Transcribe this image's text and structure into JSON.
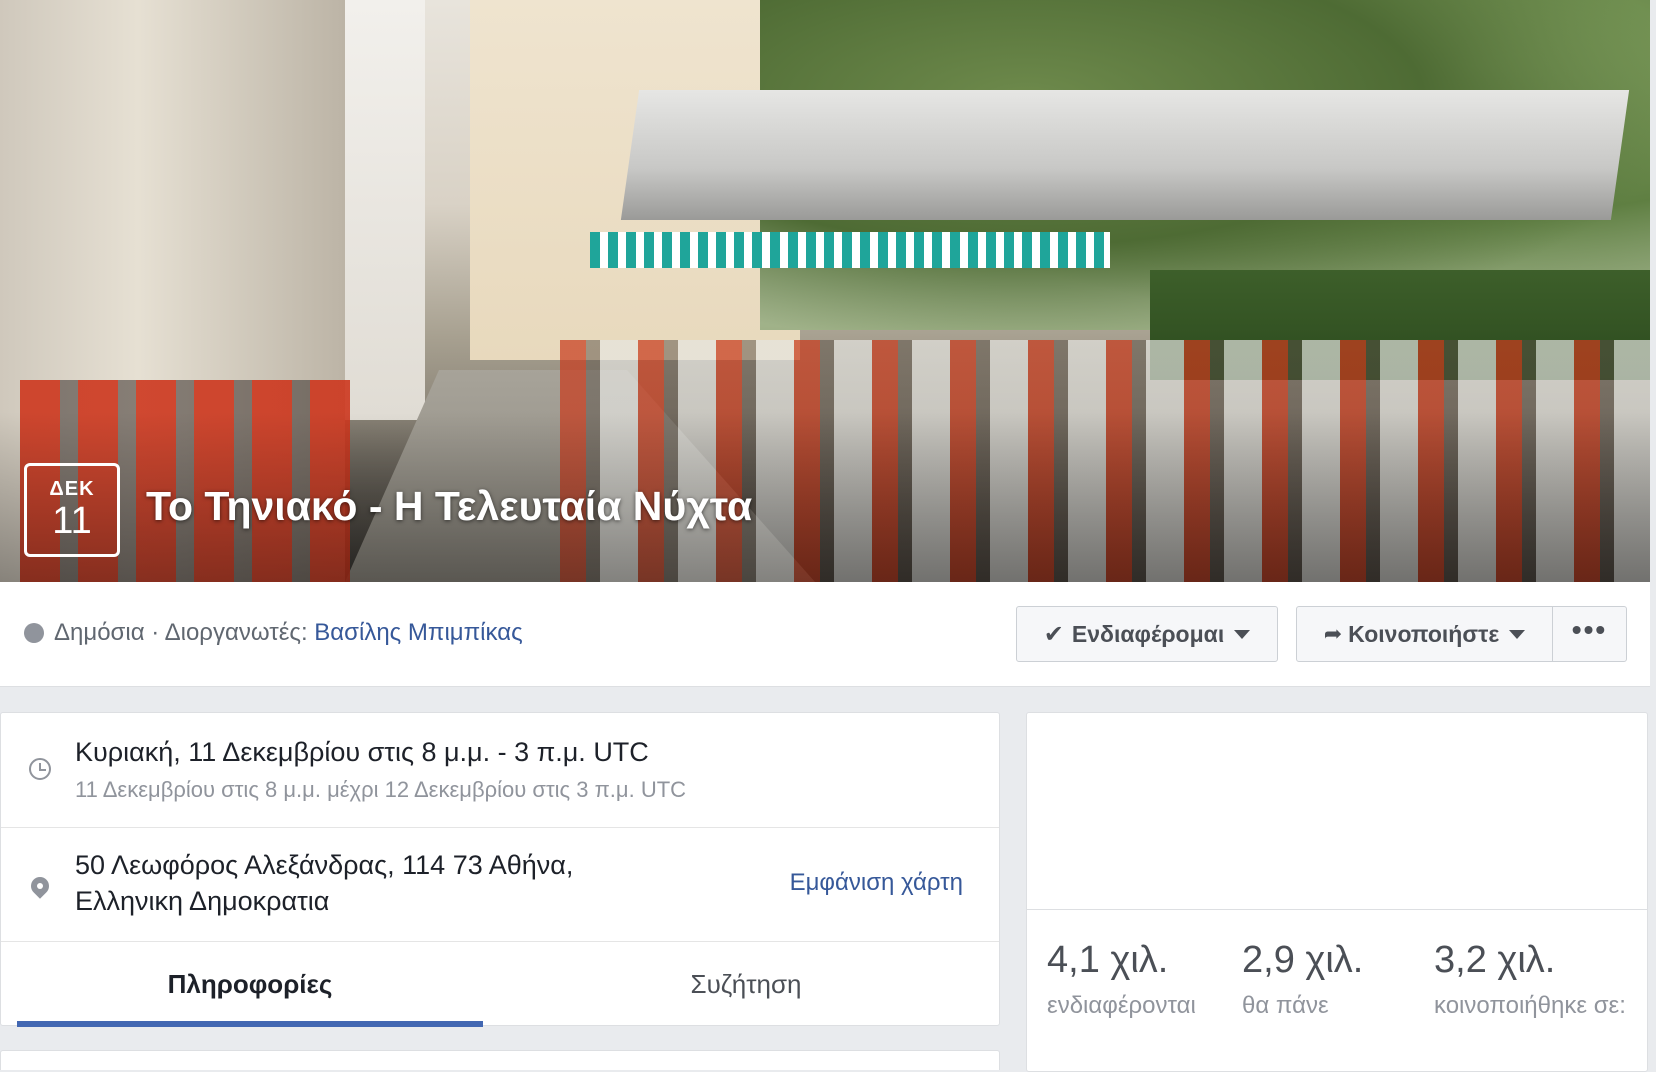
{
  "event": {
    "month": "ΔΕΚ",
    "day": "11",
    "title": "Το Τηνιακό - Η Τελευταία Νύχτα"
  },
  "meta": {
    "prefix": "Δημόσια · Διοργανωτές: ",
    "organizer": "Βασίλης Μπιμπίκας"
  },
  "actions": {
    "interested": "Ενδιαφέρομαι",
    "share": "Κοινοποιήστε",
    "more": "•••"
  },
  "details": {
    "time_main": "Κυριακή, 11 Δεκεμβρίου στις 8 μ.μ. - 3 π.μ. UTC",
    "time_sub": "11 Δεκεμβρίου στις 8 μ.μ. μέχρι 12 Δεκεμβρίου στις 3 π.μ. UTC",
    "address_line1": "50 Λεωφόρος Αλεξάνδρας, 114 73 Αθήνα,",
    "address_line2": "Ελληνικη Δημοκρατια",
    "map_link": "Εμφάνιση χάρτη"
  },
  "tabs": [
    {
      "label": "Πληροφορίες"
    },
    {
      "label": "Συζήτηση"
    }
  ],
  "stats": [
    {
      "value": "4,1 χιλ.",
      "label": "ενδιαφέρονται"
    },
    {
      "value": "2,9 χιλ.",
      "label": "θα πάνε"
    },
    {
      "value": "3,2 χιλ.",
      "label": "κοινοποιήθηκε σε:"
    }
  ],
  "colors": {
    "link": "#365899",
    "tab_underline": "#4267b2",
    "page_bg": "#e9ebee"
  },
  "icons": [
    "globe-icon",
    "check-icon",
    "chevron-down-icon",
    "share-icon",
    "more-icon",
    "clock-icon",
    "map-pin-icon"
  ]
}
